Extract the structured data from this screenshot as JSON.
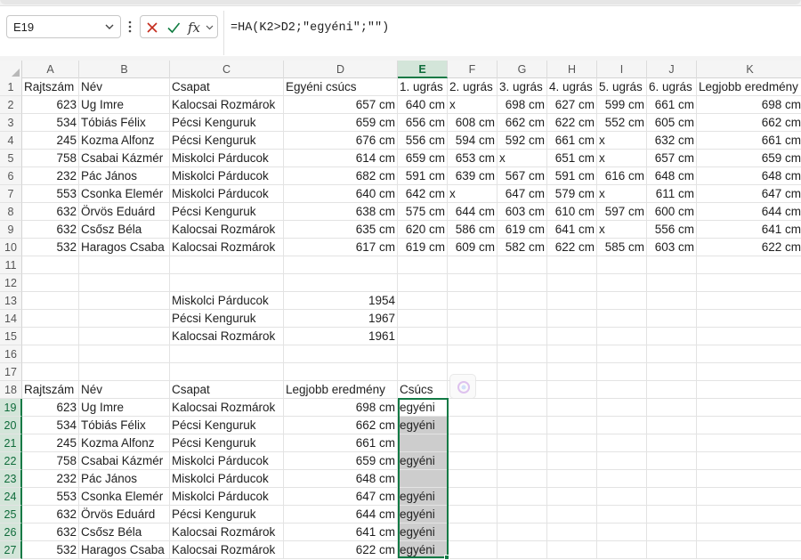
{
  "formula_bar": {
    "name_box": "E19",
    "formula": "=HA(K2>D2;\"egyéni\";\"\")",
    "icons": [
      "chevron-down-icon",
      "more-vertical-icon",
      "cancel-icon",
      "enter-check-icon",
      "insert-function-icon"
    ]
  },
  "columns": [
    {
      "id": "A",
      "label": "A"
    },
    {
      "id": "B",
      "label": "B"
    },
    {
      "id": "C",
      "label": "C"
    },
    {
      "id": "D",
      "label": "D"
    },
    {
      "id": "E",
      "label": "E"
    },
    {
      "id": "F",
      "label": "F"
    },
    {
      "id": "G",
      "label": "G"
    },
    {
      "id": "H",
      "label": "H"
    },
    {
      "id": "I",
      "label": "I"
    },
    {
      "id": "J",
      "label": "J"
    },
    {
      "id": "K",
      "label": "K"
    }
  ],
  "selected_column": "E",
  "selected_range": "E19:E27",
  "rows": [
    {
      "n": "1",
      "cells": [
        "Rajtszám",
        "Név",
        "Csapat",
        "Egyéni csúcs",
        "1. ugrás",
        "2. ugrás",
        "3. ugrás",
        "4. ugrás",
        "5. ugrás",
        "6. ugrás",
        "Legjobb eredmény"
      ]
    },
    {
      "n": "2",
      "cells": [
        "623",
        "Ug Imre",
        "Kalocsai Rozmárok",
        "657 cm",
        "640 cm",
        "x",
        "698 cm",
        "627 cm",
        "599 cm",
        "661 cm",
        "698 cm"
      ]
    },
    {
      "n": "3",
      "cells": [
        "534",
        "Tóbiás Félix",
        "Pécsi Kenguruk",
        "659 cm",
        "656 cm",
        "608 cm",
        "662 cm",
        "622 cm",
        "552 cm",
        "605 cm",
        "662 cm"
      ]
    },
    {
      "n": "4",
      "cells": [
        "245",
        "Kozma Alfonz",
        "Pécsi Kenguruk",
        "676 cm",
        "556 cm",
        "594 cm",
        "592 cm",
        "661 cm",
        "x",
        "632 cm",
        "661 cm"
      ]
    },
    {
      "n": "5",
      "cells": [
        "758",
        "Csabai Kázmér",
        "Miskolci Párducok",
        "614 cm",
        "659 cm",
        "653 cm",
        "x",
        "651 cm",
        "x",
        "657 cm",
        "659 cm"
      ]
    },
    {
      "n": "6",
      "cells": [
        "232",
        "Pác János",
        "Miskolci Párducok",
        "682 cm",
        "591 cm",
        "639 cm",
        "567 cm",
        "591 cm",
        "616 cm",
        "648 cm",
        "648 cm"
      ]
    },
    {
      "n": "7",
      "cells": [
        "553",
        "Csonka Elemér",
        "Miskolci Párducok",
        "640 cm",
        "642 cm",
        "x",
        "647 cm",
        "579 cm",
        "x",
        "611 cm",
        "647 cm"
      ]
    },
    {
      "n": "8",
      "cells": [
        "632",
        "Örvös Eduárd",
        "Pécsi Kenguruk",
        "638 cm",
        "575 cm",
        "644 cm",
        "603 cm",
        "610 cm",
        "597 cm",
        "600 cm",
        "644 cm"
      ]
    },
    {
      "n": "9",
      "cells": [
        "632",
        "Csősz Béla",
        "Kalocsai Rozmárok",
        "635 cm",
        "620 cm",
        "586 cm",
        "619 cm",
        "641 cm",
        "x",
        "556 cm",
        "641 cm"
      ]
    },
    {
      "n": "10",
      "cells": [
        "532",
        "Haragos Csaba",
        "Kalocsai Rozmárok",
        "617 cm",
        "619 cm",
        "609 cm",
        "582 cm",
        "622 cm",
        "585 cm",
        "603 cm",
        "622 cm"
      ]
    },
    {
      "n": "11",
      "cells": [
        "",
        "",
        "",
        "",
        "",
        "",
        "",
        "",
        "",
        "",
        ""
      ]
    },
    {
      "n": "12",
      "cells": [
        "",
        "",
        "",
        "",
        "",
        "",
        "",
        "",
        "",
        "",
        ""
      ]
    },
    {
      "n": "13",
      "cells": [
        "",
        "",
        "Miskolci Párducok",
        "1954",
        "",
        "",
        "",
        "",
        "",
        "",
        ""
      ]
    },
    {
      "n": "14",
      "cells": [
        "",
        "",
        "Pécsi Kenguruk",
        "1967",
        "",
        "",
        "",
        "",
        "",
        "",
        ""
      ]
    },
    {
      "n": "15",
      "cells": [
        "",
        "",
        "Kalocsai Rozmárok",
        "1961",
        "",
        "",
        "",
        "",
        "",
        "",
        ""
      ]
    },
    {
      "n": "16",
      "cells": [
        "",
        "",
        "",
        "",
        "",
        "",
        "",
        "",
        "",
        "",
        ""
      ]
    },
    {
      "n": "17",
      "cells": [
        "",
        "",
        "",
        "",
        "",
        "",
        "",
        "",
        "",
        "",
        ""
      ]
    },
    {
      "n": "18",
      "cells": [
        "Rajtszám",
        "Név",
        "Csapat",
        "Legjobb eredmény",
        "Csúcs",
        "",
        "",
        "",
        "",
        "",
        ""
      ]
    },
    {
      "n": "19",
      "cells": [
        "623",
        "Ug Imre",
        "Kalocsai Rozmárok",
        "698 cm",
        "egyéni",
        "",
        "",
        "",
        "",
        "",
        ""
      ]
    },
    {
      "n": "20",
      "cells": [
        "534",
        "Tóbiás Félix",
        "Pécsi Kenguruk",
        "662 cm",
        "egyéni",
        "",
        "",
        "",
        "",
        "",
        ""
      ]
    },
    {
      "n": "21",
      "cells": [
        "245",
        "Kozma Alfonz",
        "Pécsi Kenguruk",
        "661 cm",
        "",
        "",
        "",
        "",
        "",
        "",
        ""
      ]
    },
    {
      "n": "22",
      "cells": [
        "758",
        "Csabai Kázmér",
        "Miskolci Párducok",
        "659 cm",
        "egyéni",
        "",
        "",
        "",
        "",
        "",
        ""
      ]
    },
    {
      "n": "23",
      "cells": [
        "232",
        "Pác János",
        "Miskolci Párducok",
        "648 cm",
        "",
        "",
        "",
        "",
        "",
        "",
        ""
      ]
    },
    {
      "n": "24",
      "cells": [
        "553",
        "Csonka Elemér",
        "Miskolci Párducok",
        "647 cm",
        "egyéni",
        "",
        "",
        "",
        "",
        "",
        ""
      ]
    },
    {
      "n": "25",
      "cells": [
        "632",
        "Örvös Eduárd",
        "Pécsi Kenguruk",
        "644 cm",
        "egyéni",
        "",
        "",
        "",
        "",
        "",
        ""
      ]
    },
    {
      "n": "26",
      "cells": [
        "632",
        "Csősz Béla",
        "Kalocsai Rozmárok",
        "641 cm",
        "egyéni",
        "",
        "",
        "",
        "",
        "",
        ""
      ]
    },
    {
      "n": "27",
      "cells": [
        "532",
        "Haragos Csaba",
        "Kalocsai Rozmárok",
        "622 cm",
        "egyéni",
        "",
        "",
        "",
        "",
        "",
        ""
      ]
    }
  ],
  "colors": {
    "selection_accent": "#127a45",
    "selection_header_bg": "#d3e5d9",
    "selected_range_fill": "#cdcdcd",
    "cancel_icon": "#c42b1c",
    "enter_icon": "#107c41"
  }
}
